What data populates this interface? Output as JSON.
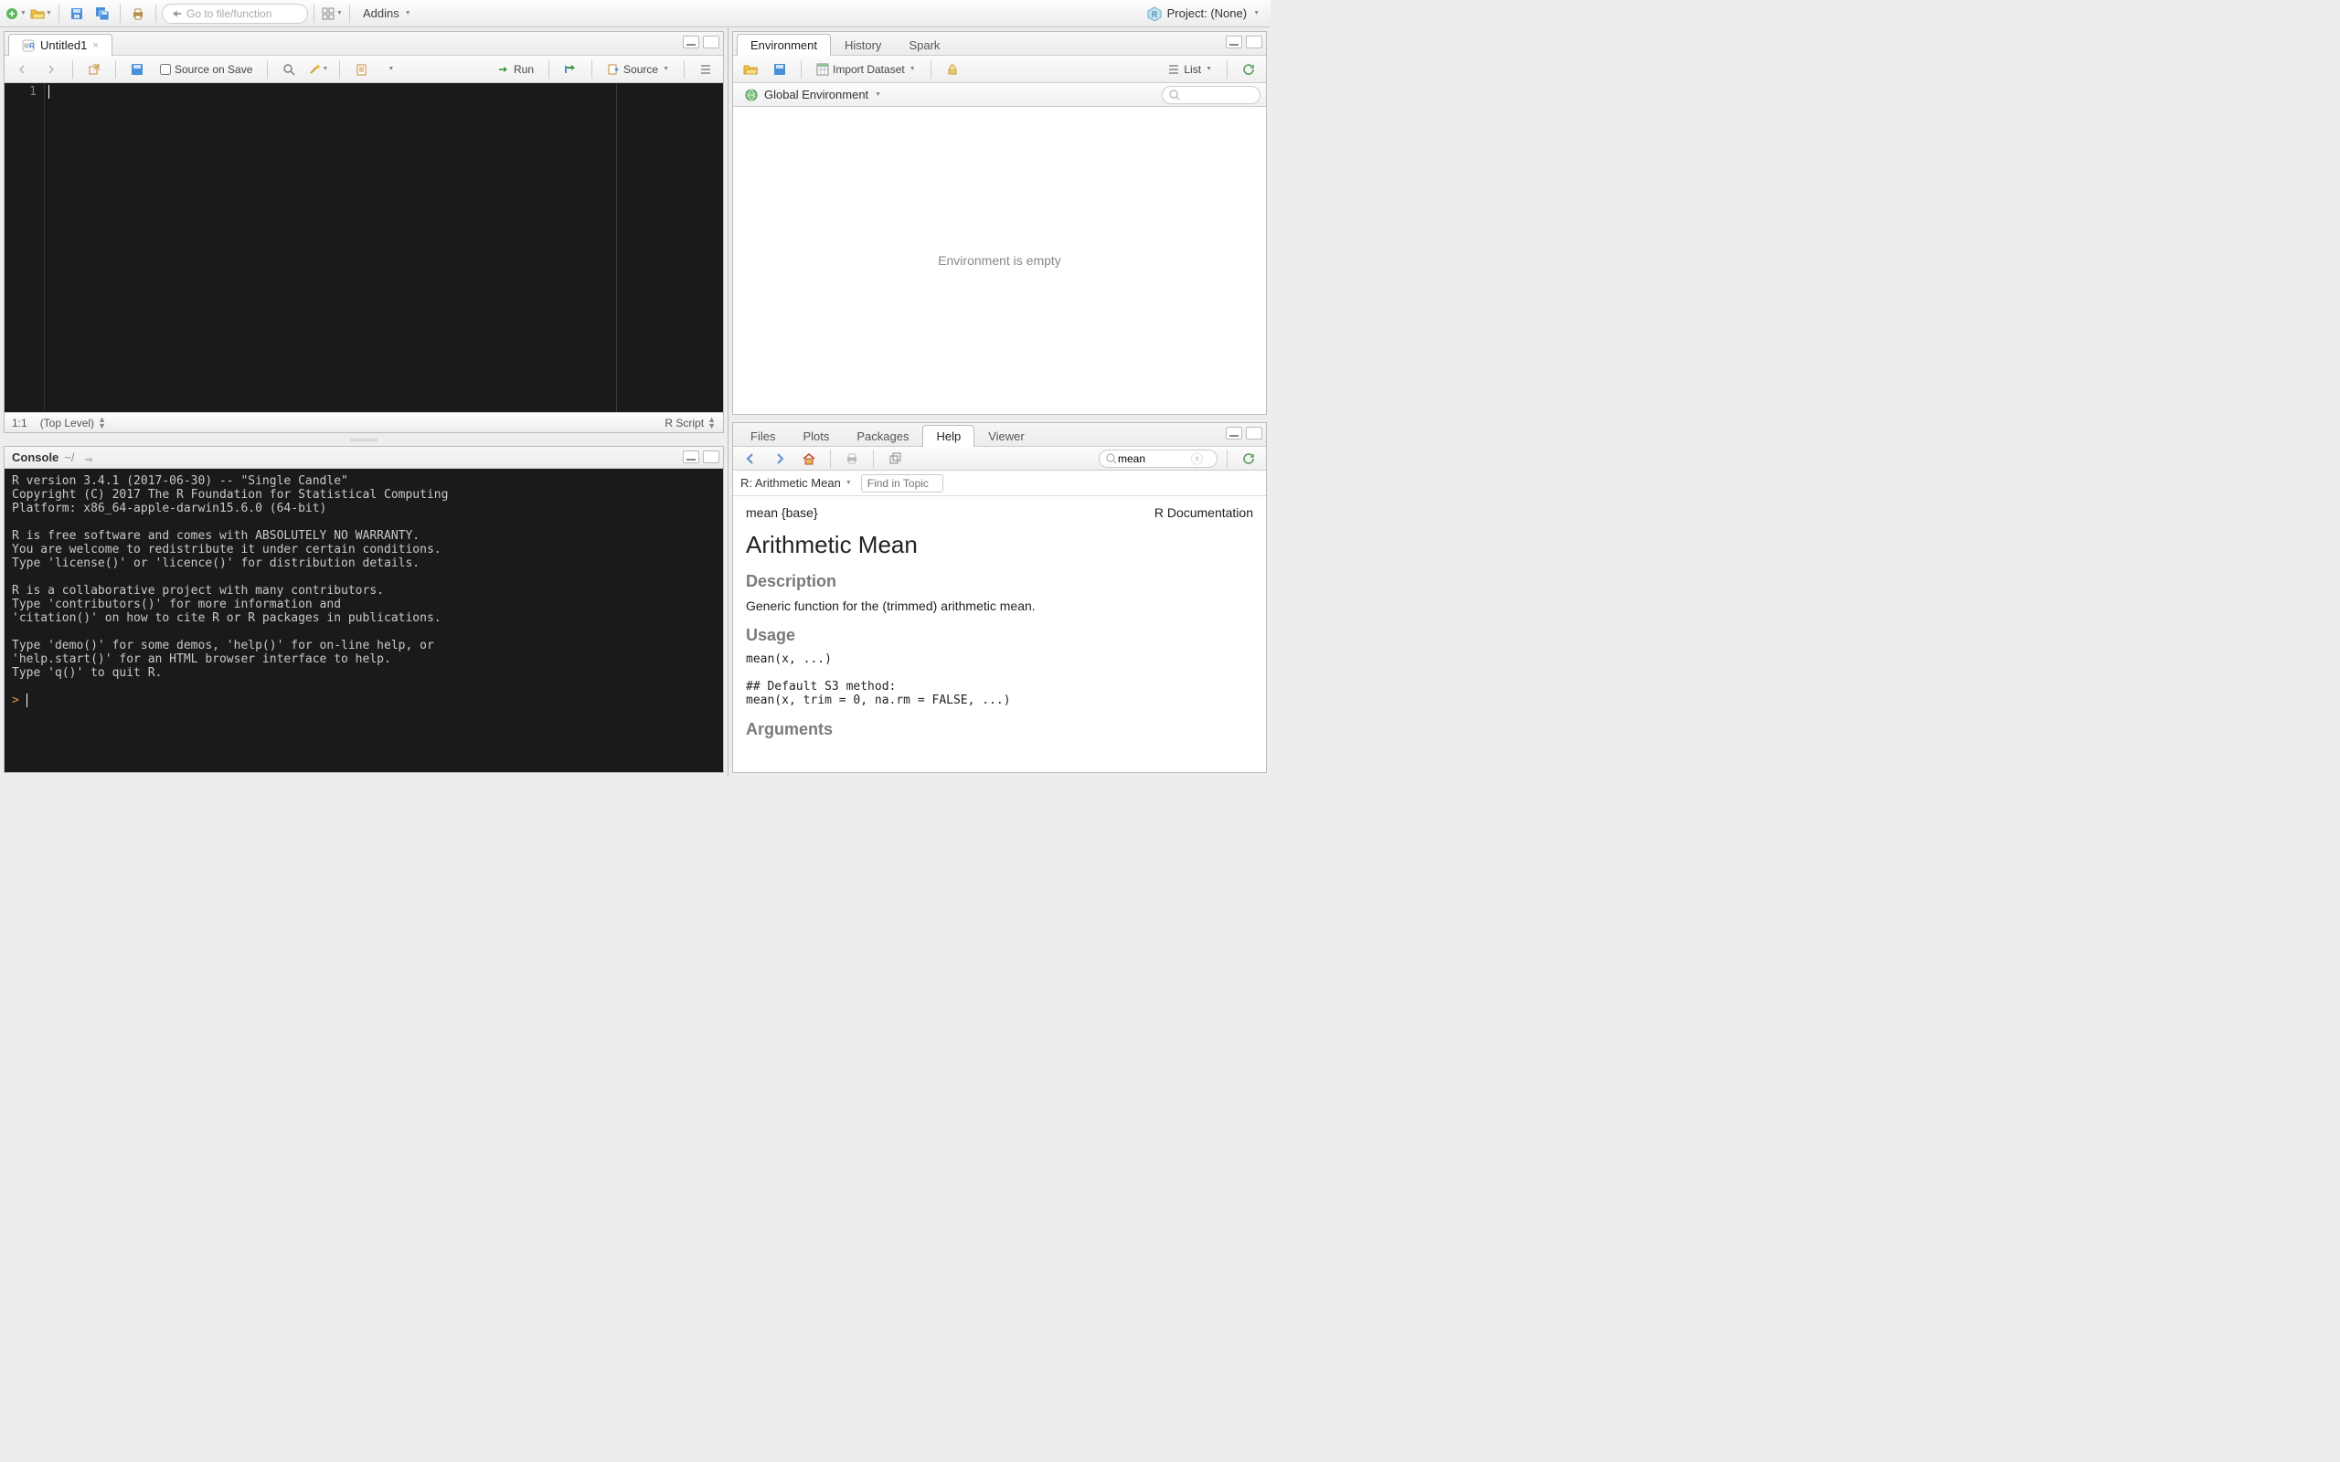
{
  "toolbar": {
    "goto_placeholder": "Go to file/function",
    "addins_label": "Addins",
    "project_label": "Project: (None)"
  },
  "editor": {
    "tab_label": "Untitled1",
    "source_on_save_label": "Source on Save",
    "run_label": "Run",
    "source_label": "Source",
    "gutter_line": "1",
    "status_pos": "1:1",
    "status_scope": "(Top Level)",
    "status_type": "R Script"
  },
  "console": {
    "title": "Console",
    "path": "~/",
    "text": "R version 3.4.1 (2017-06-30) -- \"Single Candle\"\nCopyright (C) 2017 The R Foundation for Statistical Computing\nPlatform: x86_64-apple-darwin15.6.0 (64-bit)\n\nR is free software and comes with ABSOLUTELY NO WARRANTY.\nYou are welcome to redistribute it under certain conditions.\nType 'license()' or 'licence()' for distribution details.\n\nR is a collaborative project with many contributors.\nType 'contributors()' for more information and\n'citation()' on how to cite R or R packages in publications.\n\nType 'demo()' for some demos, 'help()' for on-line help, or\n'help.start()' for an HTML browser interface to help.\nType 'q()' to quit R.\n",
    "prompt": ">"
  },
  "env": {
    "tabs": [
      "Environment",
      "History",
      "Spark"
    ],
    "import_label": "Import Dataset",
    "list_label": "List",
    "scope_label": "Global Environment",
    "empty_msg": "Environment is empty"
  },
  "help": {
    "tabs": [
      "Files",
      "Plots",
      "Packages",
      "Help",
      "Viewer"
    ],
    "search_value": "mean",
    "crumb": "R: Arithmetic Mean",
    "find_placeholder": "Find in Topic",
    "page": {
      "sig": "mean {base}",
      "doclabel": "R Documentation",
      "title": "Arithmetic Mean",
      "h_desc": "Description",
      "desc": "Generic function for the (trimmed) arithmetic mean.",
      "h_usage": "Usage",
      "usage": "mean(x, ...)\n\n## Default S3 method:\nmean(x, trim = 0, na.rm = FALSE, ...)",
      "h_args": "Arguments"
    }
  }
}
